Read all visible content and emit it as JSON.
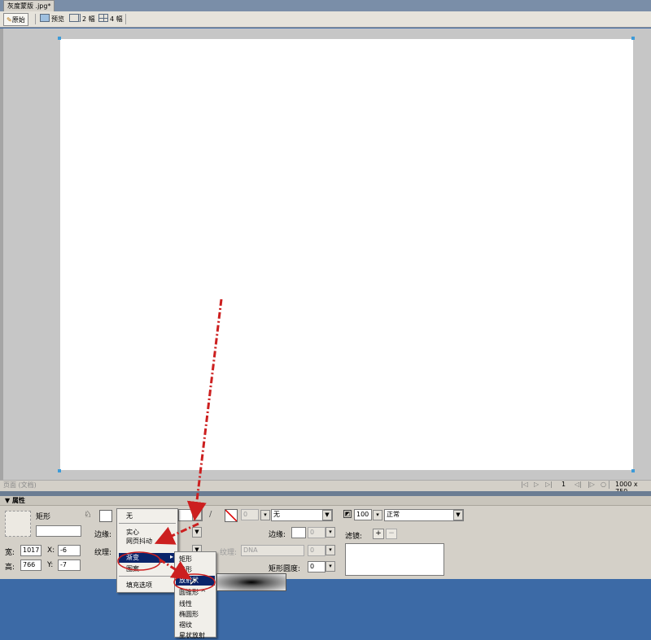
{
  "document_tab": {
    "title": "灰度蒙版 .jpg*"
  },
  "toolbar": {
    "original": "原始",
    "preview": "预览",
    "two_up": "2 幅",
    "four_up": "4 幅"
  },
  "status": {
    "left": "页面 (文档)",
    "page": "1",
    "size": "1000 x 750"
  },
  "panel": {
    "title": "▼ 属性",
    "shape_name": "矩形",
    "width_label": "宽:",
    "width_value": "1017",
    "height_label": "高:",
    "height_value": "766",
    "x_label": "X:",
    "x_value": "-6",
    "y_label": "Y:",
    "y_value": "-7",
    "fill_edge_label": "边缘:",
    "fill_texture_label": "纹理:",
    "stroke_size_value": "0",
    "stroke_type_value": "无",
    "stroke_edge_label": "边缘:",
    "stroke_edge_value": "0",
    "stroke_texture_label": "纹理:",
    "stroke_texture_value": "DNA",
    "stroke_texture_amount": "0",
    "roundness_label": "矩形圆度:",
    "roundness_value": "0",
    "opacity_value": "100",
    "blend_mode_value": "正常",
    "filters_label": "滤镜:",
    "filters_add": "+",
    "filters_remove": "−"
  },
  "fill_menu": {
    "items": [
      "无",
      "实心",
      "网页抖动",
      "渐变",
      "图案",
      "填充选项"
    ],
    "highlighted": "渐变"
  },
  "gradient_submenu": {
    "items": [
      "矩形",
      "锥形",
      "放射状",
      "圆锥形 ^",
      "线性",
      "椭圆形",
      "褶纹",
      "星状放射"
    ],
    "highlighted": "放射状"
  },
  "colors": {
    "arrow": "#cc1f1f",
    "menu_highlight": "#0a246a",
    "selection_handle": "#3d9bd8"
  }
}
